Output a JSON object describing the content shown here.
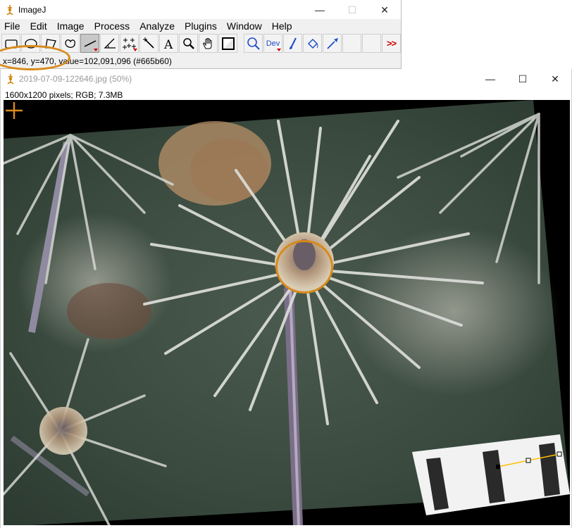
{
  "main_window": {
    "title": "ImageJ",
    "menu": [
      "File",
      "Edit",
      "Image",
      "Process",
      "Analyze",
      "Plugins",
      "Window",
      "Help"
    ],
    "tools": [
      {
        "name": "rectangle-tool",
        "icon": "rectangle-icon"
      },
      {
        "name": "oval-tool",
        "icon": "oval-icon"
      },
      {
        "name": "polygon-tool",
        "icon": "polygon-icon"
      },
      {
        "name": "freehand-tool",
        "icon": "freehand-icon"
      },
      {
        "name": "line-tool",
        "icon": "straight-line-icon",
        "selected": true
      },
      {
        "name": "angle-tool",
        "icon": "angle-icon"
      },
      {
        "name": "point-tool",
        "icon": "multipoint-icon"
      },
      {
        "name": "wand-tool",
        "icon": "wand-icon"
      },
      {
        "name": "text-tool",
        "icon": "text-icon",
        "label": "A"
      },
      {
        "name": "magnifier-tool",
        "icon": "magnifier-icon"
      },
      {
        "name": "hand-tool",
        "icon": "hand-icon"
      },
      {
        "name": "color-picker-tool",
        "icon": "color-picker-icon"
      },
      {
        "name": "zoom-tool",
        "icon": "zoom-search-icon"
      },
      {
        "name": "developer-menu",
        "icon": "dev-icon",
        "label": "Dev"
      },
      {
        "name": "brush-tool",
        "icon": "brush-icon"
      },
      {
        "name": "flood-fill-tool",
        "icon": "flood-fill-icon"
      },
      {
        "name": "pick-tool",
        "icon": "pipette-icon"
      },
      {
        "name": "empty-slot-1",
        "icon": "empty-icon"
      },
      {
        "name": "empty-slot-2",
        "icon": "empty-icon"
      },
      {
        "name": "more-tools",
        "icon": "more-tools-icon",
        "label": ">>"
      }
    ],
    "status": "x=846, y=470, value=102,091,096 (#665b60)"
  },
  "image_window": {
    "title": "2019-07-09-122646.jpg (50%)",
    "info": "1600x1200 pixels; RGB; 7.3MB"
  },
  "colors": {
    "highlight_ring": "#d88a1a",
    "line_selection": "#ffc000",
    "status_value": "#665b60",
    "spine": "#d9dbd6",
    "background_green": "#3a4a3e"
  }
}
